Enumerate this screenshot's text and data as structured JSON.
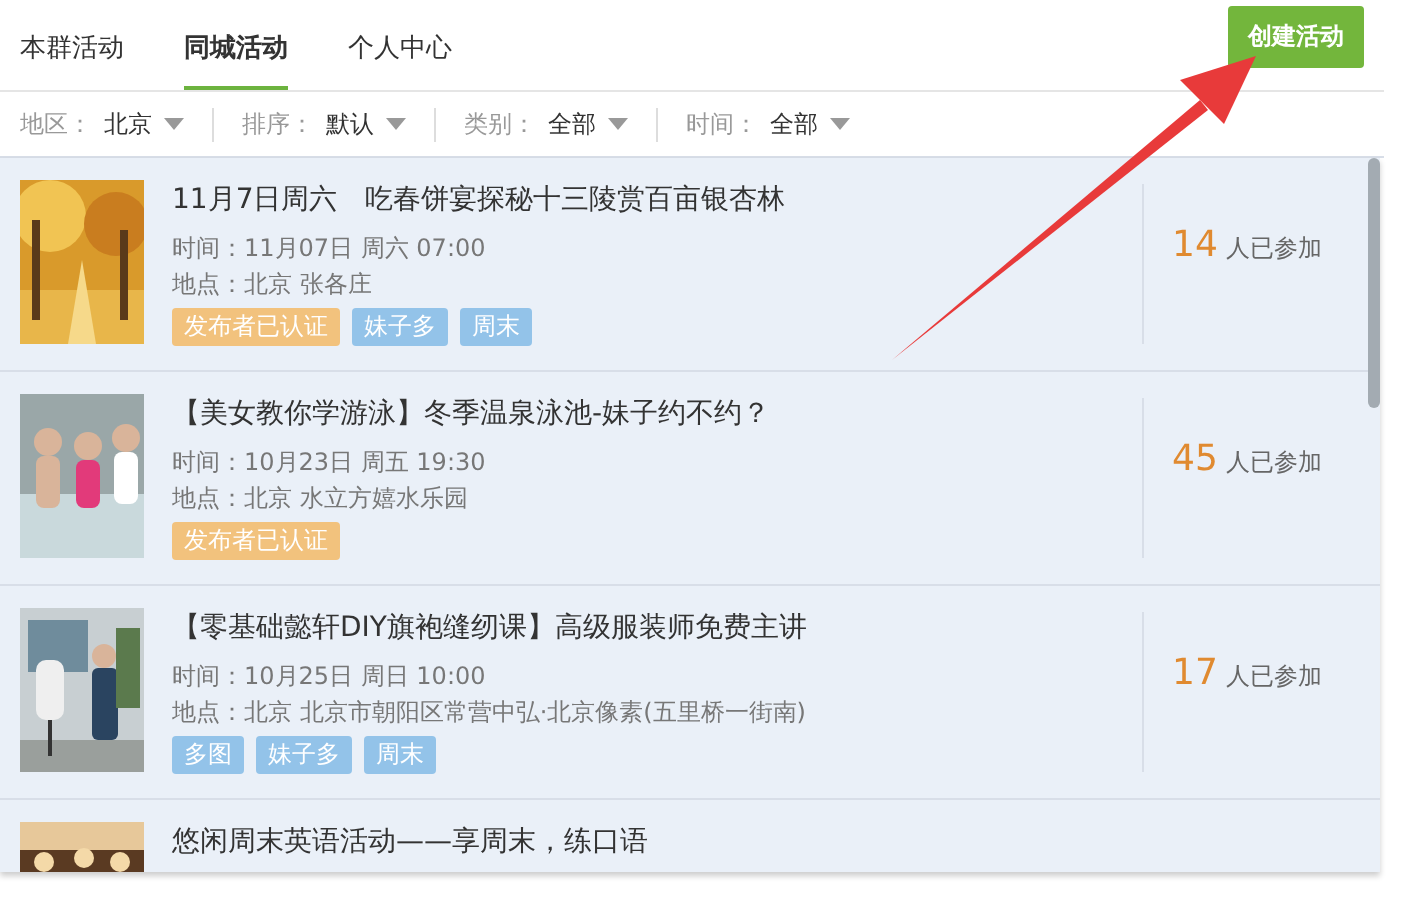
{
  "tabs": [
    {
      "label": "本群活动",
      "selected": false
    },
    {
      "label": "同城活动",
      "selected": true
    },
    {
      "label": "个人中心",
      "selected": false
    }
  ],
  "create_button": "创建活动",
  "filters": [
    {
      "label": "地区：",
      "value": "北京"
    },
    {
      "label": "排序：",
      "value": "默认"
    },
    {
      "label": "类别：",
      "value": "全部"
    },
    {
      "label": "时间：",
      "value": "全部"
    }
  ],
  "events": [
    {
      "title": "11月7日周六　吃春饼宴探秘十三陵赏百亩银杏林",
      "time": "时间：11月07日 周六 07:00",
      "place": "地点：北京 张各庄",
      "tags": [
        {
          "text": "发布者已认证",
          "kind": "verified"
        },
        {
          "text": "妹子多",
          "kind": "normal"
        },
        {
          "text": "周末",
          "kind": "normal"
        }
      ],
      "count": "14",
      "count_label": "人已参加"
    },
    {
      "title": "【美女教你学游泳】冬季温泉泳池-妹子约不约？",
      "time": "时间：10月23日 周五 19:30",
      "place": "地点：北京 水立方嬉水乐园",
      "tags": [
        {
          "text": "发布者已认证",
          "kind": "verified"
        }
      ],
      "count": "45",
      "count_label": "人已参加"
    },
    {
      "title": "【零基础懿轩DIY旗袍缝纫课】高级服装师免费主讲",
      "time": "时间：10月25日 周日 10:00",
      "place": "地点：北京 北京市朝阳区常营中弘·北京像素(五里桥一街南)",
      "tags": [
        {
          "text": "多图",
          "kind": "normal"
        },
        {
          "text": "妹子多",
          "kind": "normal"
        },
        {
          "text": "周末",
          "kind": "normal"
        }
      ],
      "count": "17",
      "count_label": "人已参加"
    },
    {
      "title": "悠闲周末英语活动——享周末，练口语"
    }
  ]
}
